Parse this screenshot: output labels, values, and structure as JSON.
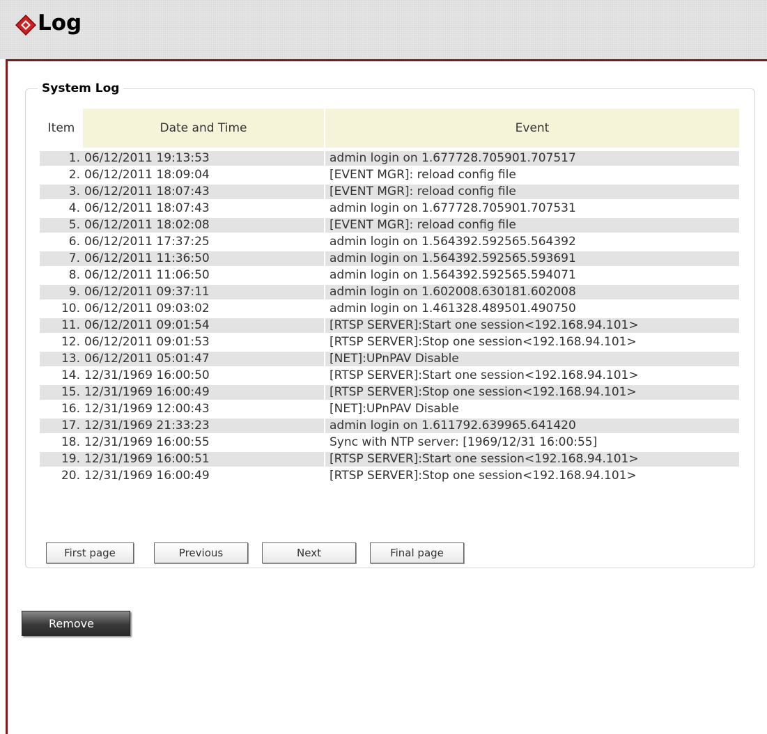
{
  "header": {
    "title": "Log",
    "logo_icon": "red-diamond-logo-icon"
  },
  "section": {
    "title": "System Log"
  },
  "table": {
    "headers": [
      "Item",
      "Date and Time",
      "Event"
    ],
    "rows": [
      {
        "item": "1.",
        "datetime": "06/12/2011 19:13:53",
        "event": "admin login on 1.677728.705901.707517"
      },
      {
        "item": "2.",
        "datetime": "06/12/2011 18:09:04",
        "event": "[EVENT MGR]: reload config file"
      },
      {
        "item": "3.",
        "datetime": "06/12/2011 18:07:43",
        "event": "[EVENT MGR]: reload config file"
      },
      {
        "item": "4.",
        "datetime": "06/12/2011 18:07:43",
        "event": "admin login on 1.677728.705901.707531"
      },
      {
        "item": "5.",
        "datetime": "06/12/2011 18:02:08",
        "event": "[EVENT MGR]: reload config file"
      },
      {
        "item": "6.",
        "datetime": "06/12/2011 17:37:25",
        "event": "admin login on 1.564392.592565.564392"
      },
      {
        "item": "7.",
        "datetime": "06/12/2011 11:36:50",
        "event": "admin login on 1.564392.592565.593691"
      },
      {
        "item": "8.",
        "datetime": "06/12/2011 11:06:50",
        "event": "admin login on 1.564392.592565.594071"
      },
      {
        "item": "9.",
        "datetime": "06/12/2011 09:37:11",
        "event": "admin login on 1.602008.630181.602008"
      },
      {
        "item": "10.",
        "datetime": "06/12/2011 09:03:02",
        "event": "admin login on 1.461328.489501.490750"
      },
      {
        "item": "11.",
        "datetime": "06/12/2011 09:01:54",
        "event": "[RTSP SERVER]:Start one session<192.168.94.101>"
      },
      {
        "item": "12.",
        "datetime": "06/12/2011 09:01:53",
        "event": "[RTSP SERVER]:Stop one session<192.168.94.101>"
      },
      {
        "item": "13.",
        "datetime": "06/12/2011 05:01:47",
        "event": "[NET]:UPnPAV Disable"
      },
      {
        "item": "14.",
        "datetime": "12/31/1969 16:00:50",
        "event": "[RTSP SERVER]:Start one session<192.168.94.101>"
      },
      {
        "item": "15.",
        "datetime": "12/31/1969 16:00:49",
        "event": "[RTSP SERVER]:Stop one session<192.168.94.101>"
      },
      {
        "item": "16.",
        "datetime": "12/31/1969 12:00:43",
        "event": "[NET]:UPnPAV Disable"
      },
      {
        "item": "17.",
        "datetime": "12/31/1969 21:33:23",
        "event": "admin login on 1.611792.639965.641420"
      },
      {
        "item": "18.",
        "datetime": "12/31/1969 16:00:55",
        "event": "Sync with NTP server: [1969/12/31 16:00:55]"
      },
      {
        "item": "19.",
        "datetime": "12/31/1969 16:00:51",
        "event": "[RTSP SERVER]:Start one session<192.168.94.101>"
      },
      {
        "item": "20.",
        "datetime": "12/31/1969 16:00:49",
        "event": "[RTSP SERVER]:Stop one session<192.168.94.101>"
      }
    ]
  },
  "pager": {
    "first": "First page",
    "previous": "Previous",
    "next": "Next",
    "final": "Final page"
  },
  "actions": {
    "remove": "Remove"
  },
  "colors": {
    "accent_border": "#7f1a1a",
    "header_cell_bg": "#f6f4d8",
    "stripe_bg": "#e3e3e3"
  }
}
